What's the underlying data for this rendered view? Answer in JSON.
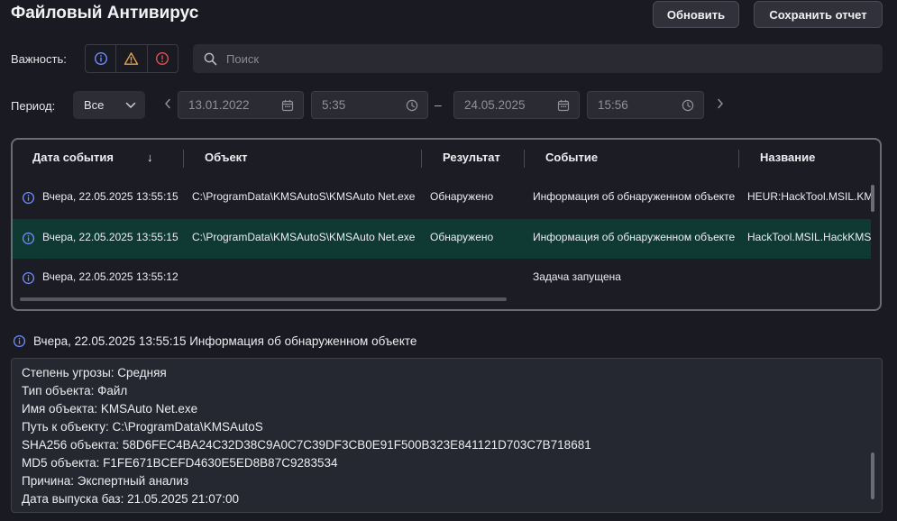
{
  "header": {
    "title": "Файловый Антивирус",
    "refresh_label": "Обновить",
    "save_report_label": "Сохранить отчет"
  },
  "filters": {
    "severity_label": "Важность:",
    "severity_icons": [
      "info-icon",
      "warning-icon",
      "error-icon"
    ],
    "search_placeholder": "Поиск",
    "period_label": "Период:",
    "period_value": "Все",
    "date_from": "13.01.2022",
    "time_from": "5:35",
    "date_to": "24.05.2025",
    "time_to": "15:56",
    "separator": "–"
  },
  "table": {
    "columns": [
      "Дата события",
      "Объект",
      "Результат",
      "Событие",
      "Название"
    ],
    "sort_indicator": "↓",
    "rows": [
      {
        "date": "Вчера, 22.05.2025 13:55:15",
        "object": "C:\\ProgramData\\KMSAutoS\\KMSAuto Net.exe",
        "result": "Обнаружено",
        "event": "Информация об обнаруженном объекте",
        "name": "HEUR:HackTool.MSIL.KMSAuto.gen"
      },
      {
        "date": "Вчера, 22.05.2025 13:55:15",
        "object": "C:\\ProgramData\\KMSAutoS\\KMSAuto Net.exe",
        "result": "Обнаружено",
        "event": "Информация об обнаруженном объекте",
        "name": "HackTool.MSIL.HackKMS.gen"
      },
      {
        "date": "Вчера, 22.05.2025 13:55:12",
        "object": "",
        "result": "",
        "event": "Задача запущена",
        "name": ""
      }
    ]
  },
  "details": {
    "title": "Вчера, 22.05.2025 13:55:15 Информация об обнаруженном объекте",
    "lines": [
      "Степень угрозы: Средняя",
      "Тип объекта: Файл",
      "Имя объекта: KMSAuto Net.exe",
      "Путь к объекту: C:\\ProgramData\\KMSAutoS",
      "SHA256 объекта: 58D6FEC4BA24C32D38C9A0C7C39DF3CB0E91F500B323E841121D703C7B718681",
      "MD5 объекта: F1FE671BCEFD4630E5ED8B87C9283534",
      "Причина: Экспертный анализ",
      "Дата выпуска баз: 21.05.2025 21:07:00"
    ]
  },
  "colors": {
    "info": "#6f8cff",
    "warning": "#e8a24a",
    "error": "#e0524f",
    "selected_row": "#0f3a33"
  }
}
